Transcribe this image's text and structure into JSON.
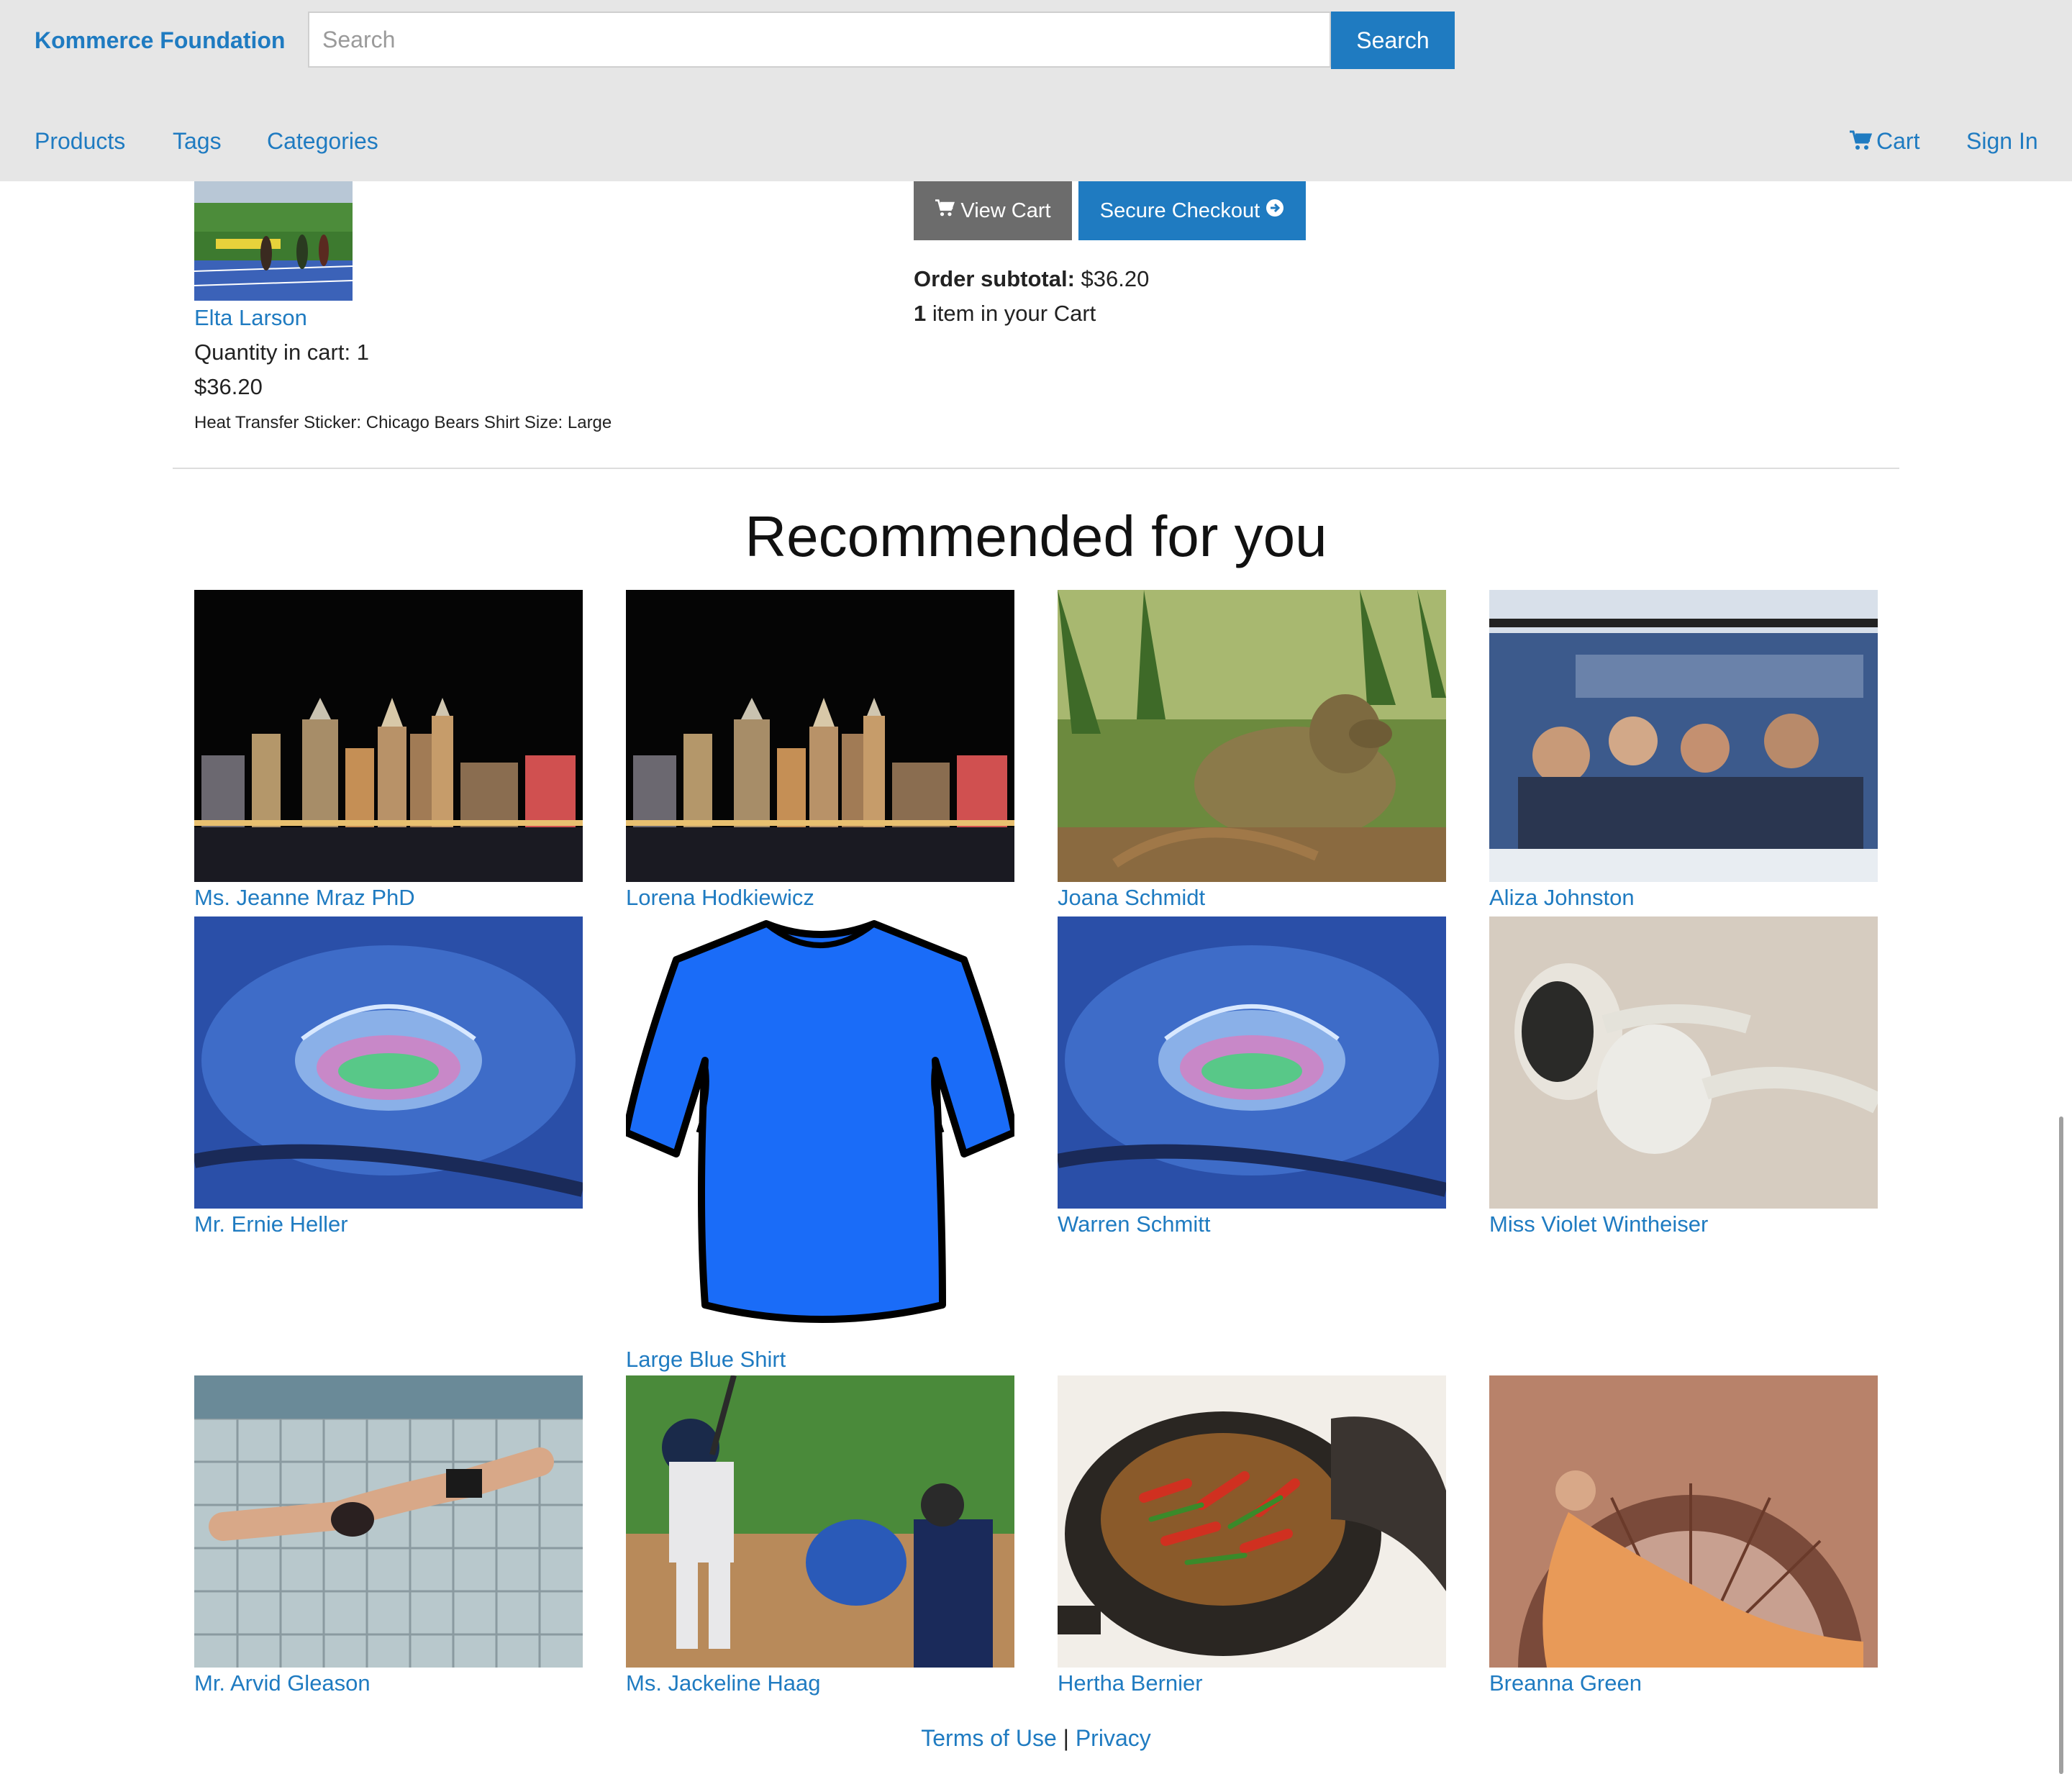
{
  "header": {
    "brand": "Kommerce Foundation",
    "search_placeholder": "Search",
    "search_button": "Search",
    "nav": [
      "Products",
      "Tags",
      "Categories"
    ],
    "cart_label": "Cart",
    "signin_label": "Sign In"
  },
  "cart_item": {
    "name": "Elta Larson",
    "quantity": "Quantity in cart: 1",
    "price": "$36.20",
    "description": "Heat Transfer Sticker: Chicago Bears Shirt Size: Large"
  },
  "cart_summary": {
    "view_cart": "View Cart",
    "checkout": "Secure Checkout",
    "subtotal_label": "Order subtotal:",
    "subtotal_value": "$36.20",
    "count": "1",
    "count_text": "item in your Cart"
  },
  "recommended": {
    "title": "Recommended for you",
    "items": [
      {
        "name": "Ms. Jeanne Mraz PhD",
        "image": "city-night"
      },
      {
        "name": "Lorena Hodkiewicz",
        "image": "city-night"
      },
      {
        "name": "Joana Schmidt",
        "image": "deer"
      },
      {
        "name": "Aliza Johnston",
        "image": "people-bus"
      },
      {
        "name": "Mr. Ernie Heller",
        "image": "water-drop"
      },
      {
        "name": "Large Blue Shirt",
        "image": "blue-shirt"
      },
      {
        "name": "Warren Schmitt",
        "image": "water-drop"
      },
      {
        "name": "Miss Violet Wintheiser",
        "image": "earbuds"
      },
      {
        "name": "Mr. Arvid Gleason",
        "image": "swimmer"
      },
      {
        "name": "Ms. Jackeline Haag",
        "image": "baseball"
      },
      {
        "name": "Hertha Bernier",
        "image": "food-pot"
      },
      {
        "name": "Breanna Green",
        "image": "woman-painting"
      }
    ]
  },
  "footer": {
    "terms": "Terms of Use",
    "separator": "|",
    "privacy": "Privacy"
  },
  "colors": {
    "link": "#1f7bc1",
    "header_bg": "#e6e6e6",
    "view_cart_bg": "#6c6c6c"
  }
}
